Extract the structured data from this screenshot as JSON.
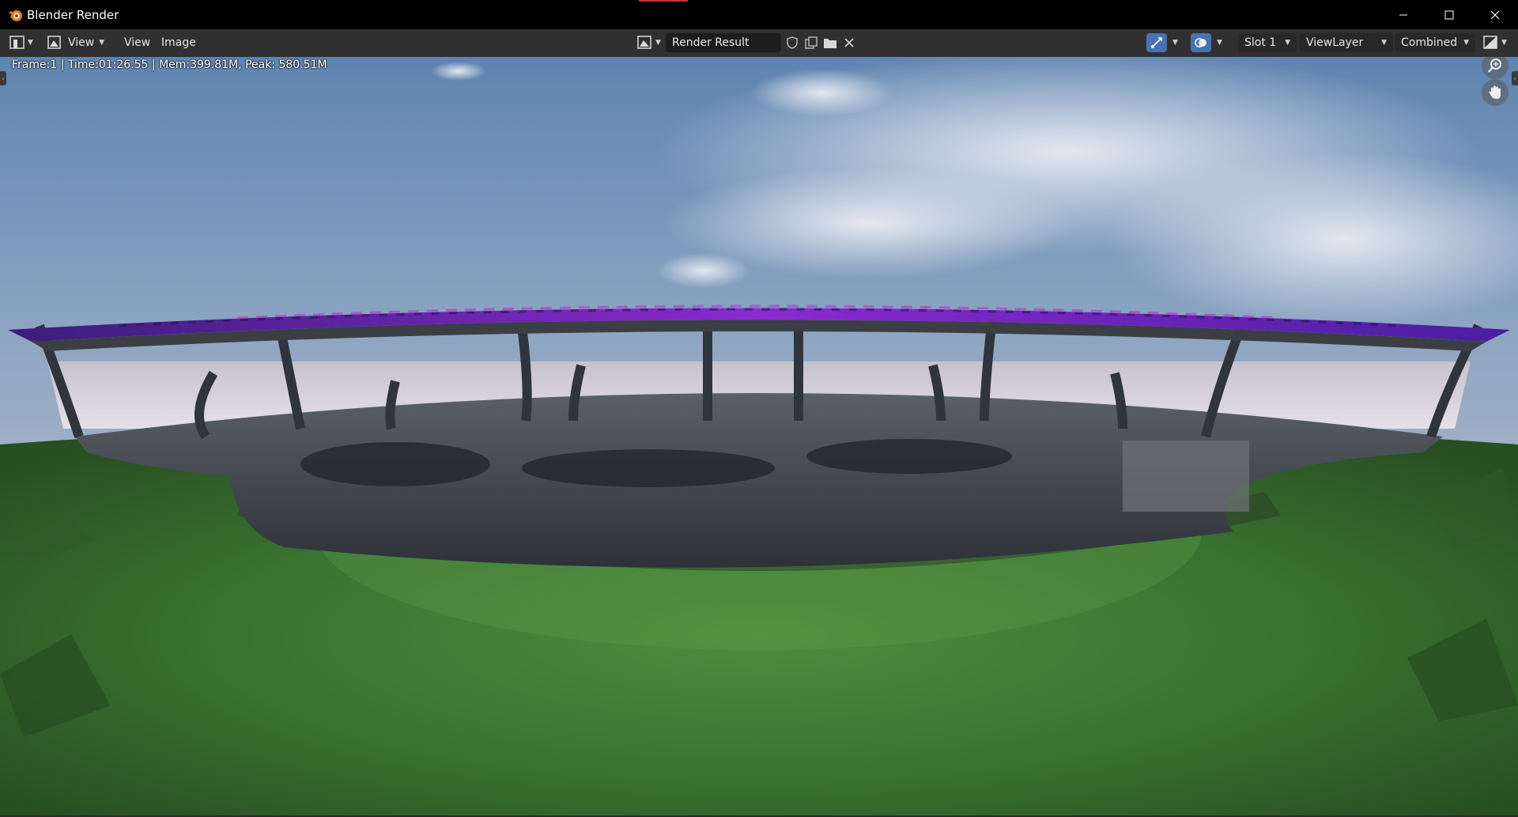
{
  "window": {
    "title": "Blender Render",
    "controls": [
      "minimize-icon",
      "maximize-icon",
      "close-icon"
    ]
  },
  "header": {
    "editor_type_icon": "image-editor-icon",
    "menus": [
      {
        "label": "View",
        "has_dropdown": true
      },
      {
        "label": "View"
      },
      {
        "label": "Image"
      }
    ],
    "image_browse_icon": "image-browse-icon",
    "image_name": "Render Result",
    "image_buttons": [
      "fake-user-shield-icon",
      "duplicate-image-icon",
      "open-folder-icon",
      "unlink-x-icon"
    ],
    "toggles": [
      "gizmo-toggle-icon",
      "overlay-toggle-icon"
    ],
    "slot": "Slot 1",
    "view_layer": "ViewLayer",
    "pass": "Combined",
    "display_mode_icon": "display-channels-icon"
  },
  "viewport": {
    "render_stats": "Frame:1 | Time:01:26.55 | Mem:399.81M, Peak: 580.51M",
    "nav_gizmos": [
      "zoom-icon",
      "pan-hand-icon"
    ]
  },
  "colors": {
    "header_bg": "#303030",
    "titlebar_bg": "#000000",
    "toggle_active": "#4772b3",
    "field_bg": "#1d1d1d"
  }
}
